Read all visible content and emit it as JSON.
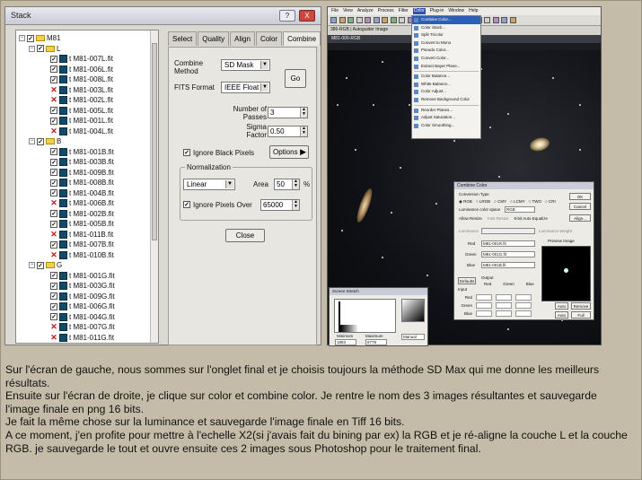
{
  "stack_window": {
    "title": "Stack",
    "help_btn": "?",
    "close_btn": "X",
    "tree": {
      "root": "M81",
      "groups": [
        {
          "name": "L",
          "files": [
            {
              "name": "t M81-007L.fit",
              "state": "check"
            },
            {
              "name": "t M81-006L.fit",
              "state": "check"
            },
            {
              "name": "t M81-008L.fit",
              "state": "check"
            },
            {
              "name": "t M81-003L.fit",
              "state": "x"
            },
            {
              "name": "t M81-002L.fit",
              "state": "x"
            },
            {
              "name": "t M81-005L.fit",
              "state": "check"
            },
            {
              "name": "t M81-001L.fit",
              "state": "check"
            },
            {
              "name": "t M81-004L.fit",
              "state": "x"
            }
          ]
        },
        {
          "name": "B",
          "files": [
            {
              "name": "t M81-001B.fit",
              "state": "check"
            },
            {
              "name": "t M81-003B.fit",
              "state": "check"
            },
            {
              "name": "t M81-009B.fit",
              "state": "check"
            },
            {
              "name": "t M81-008B.fit",
              "state": "check"
            },
            {
              "name": "t M81-004B.fit",
              "state": "check"
            },
            {
              "name": "t M81-006B.fit",
              "state": "x"
            },
            {
              "name": "t M81-002B.fit",
              "state": "check"
            },
            {
              "name": "t M81-005B.fit",
              "state": "check"
            },
            {
              "name": "t M81-011B.fit",
              "state": "x"
            },
            {
              "name": "t M81-007B.fit",
              "state": "check"
            },
            {
              "name": "t M81-010B.fit",
              "state": "x"
            }
          ]
        },
        {
          "name": "G",
          "files": [
            {
              "name": "t M81-001G.fit",
              "state": "check"
            },
            {
              "name": "t M81-003G.fit",
              "state": "check"
            },
            {
              "name": "t M81-009G.fit",
              "state": "check"
            },
            {
              "name": "t M81-006G.fit",
              "state": "check"
            },
            {
              "name": "t M81-004G.fit",
              "state": "check"
            },
            {
              "name": "t M81-007G.fit",
              "state": "x"
            },
            {
              "name": "t M81-011G.fit",
              "state": "x"
            }
          ]
        }
      ]
    },
    "tabs": [
      "Select",
      "Quality",
      "Align",
      "Color",
      "Combine"
    ],
    "active_tab": "Combine",
    "combine_method_label": "Combine Method",
    "combine_method_value": "SD Mask",
    "go_label": "Go",
    "fits_format_label": "FITS Format",
    "fits_format_value": "IEEE Float",
    "passes_label": "Number of Passes",
    "passes_value": "3",
    "sigma_label": "Sigma Factor",
    "sigma_value": "0.50",
    "ignore_black_label": "Ignore Black Pixels",
    "ignore_black_checked": true,
    "options_label": "Options",
    "normalization_label": "Normalization",
    "normalization_value": "Linear",
    "area_label": "Area",
    "area_value": "50",
    "area_unit": "%",
    "ignore_over_label": "Ignore Pixels Over",
    "ignore_over_checked": true,
    "ignore_over_value": "65000",
    "close_label": "Close"
  },
  "app_window": {
    "menus": [
      "File",
      "View",
      "Analyze",
      "Process",
      "Filter",
      "Color",
      "Plug-in",
      "Window",
      "Help"
    ],
    "active_menu": "Color",
    "toolbar2_text": "386-RGB | Autoguider Image",
    "image_title": "M81-006-RGB",
    "color_menu_items": [
      "Combine Color...",
      "Color Stack...",
      "Split Tricolor",
      "Convert to Mono",
      "Pseudo Color...",
      "Convert Color...",
      "Extract Bayer Plane...",
      "Color Balance...",
      "White Balance...",
      "Color Adjust...",
      "Remove Background Color",
      "Reorder Planes...",
      "Adjust Saturation...",
      "Color Smoothing..."
    ],
    "combine_color": {
      "title": "Combine Color",
      "conversion_type_label": "Conversion Type",
      "types": [
        "RGB",
        "LRGB",
        "CMY",
        "LCMY",
        "TWO",
        "CRI"
      ],
      "ok": "OK",
      "cancel": "Cancel",
      "align": "Align...",
      "color_space_label": "Luminance color space",
      "color_space_value": "RGB",
      "allow_resize": "Allow Resize",
      "fast_resize": "Fast Resize",
      "bayer_auto": "8-bit Auto Equalize",
      "luminance_label": "Luminance",
      "luminance_weight_label": "Luminance Weight",
      "red_label": "Red",
      "red_value": "M81-001R.fit",
      "green_label": "Green",
      "green_value": "M81-001G.fit",
      "blue_label": "Blue",
      "blue_value": "M81-001B.fit",
      "preview_label": "Preview Image",
      "defaults": "Defaults",
      "output_label": "Output",
      "output_cols": [
        "Red",
        "Green",
        "Blue"
      ],
      "input_label": "Input",
      "input_rows": [
        "Red",
        "Green",
        "Blue"
      ],
      "auto_label": "Auto",
      "remove_label": "Remove",
      "full_screen": "Full Screen"
    },
    "screen_stretch": {
      "title": "Screen Stretch",
      "minimum_label": "Minimum",
      "maximum_label": "Maximum",
      "min_value": "1883",
      "max_value": "6778",
      "mode": "Manual"
    }
  },
  "caption": [
    "Sur l'écran de gauche, nous sommes sur l'onglet final et je choisis toujours la méthode SD Max qui me donne les meilleurs résultats.",
    "Ensuite sur l'écran de droite, je clique sur color et combine color. Je rentre le nom des 3 images résultantes et sauvegarde l'image finale en png 16 bits.",
    "Je fait la même chose sur la luminance et sauvegarde l'image finale en Tiff 16 bits.",
    "A ce moment, j'en profite pour mettre à l'echelle X2(si j'avais fait du bining par ex) la RGB et je ré-aligne la couche L et la couche RGB. je sauvegarde le tout et ouvre ensuite ces 2 images sous Photoshop pour le traitement final."
  ]
}
